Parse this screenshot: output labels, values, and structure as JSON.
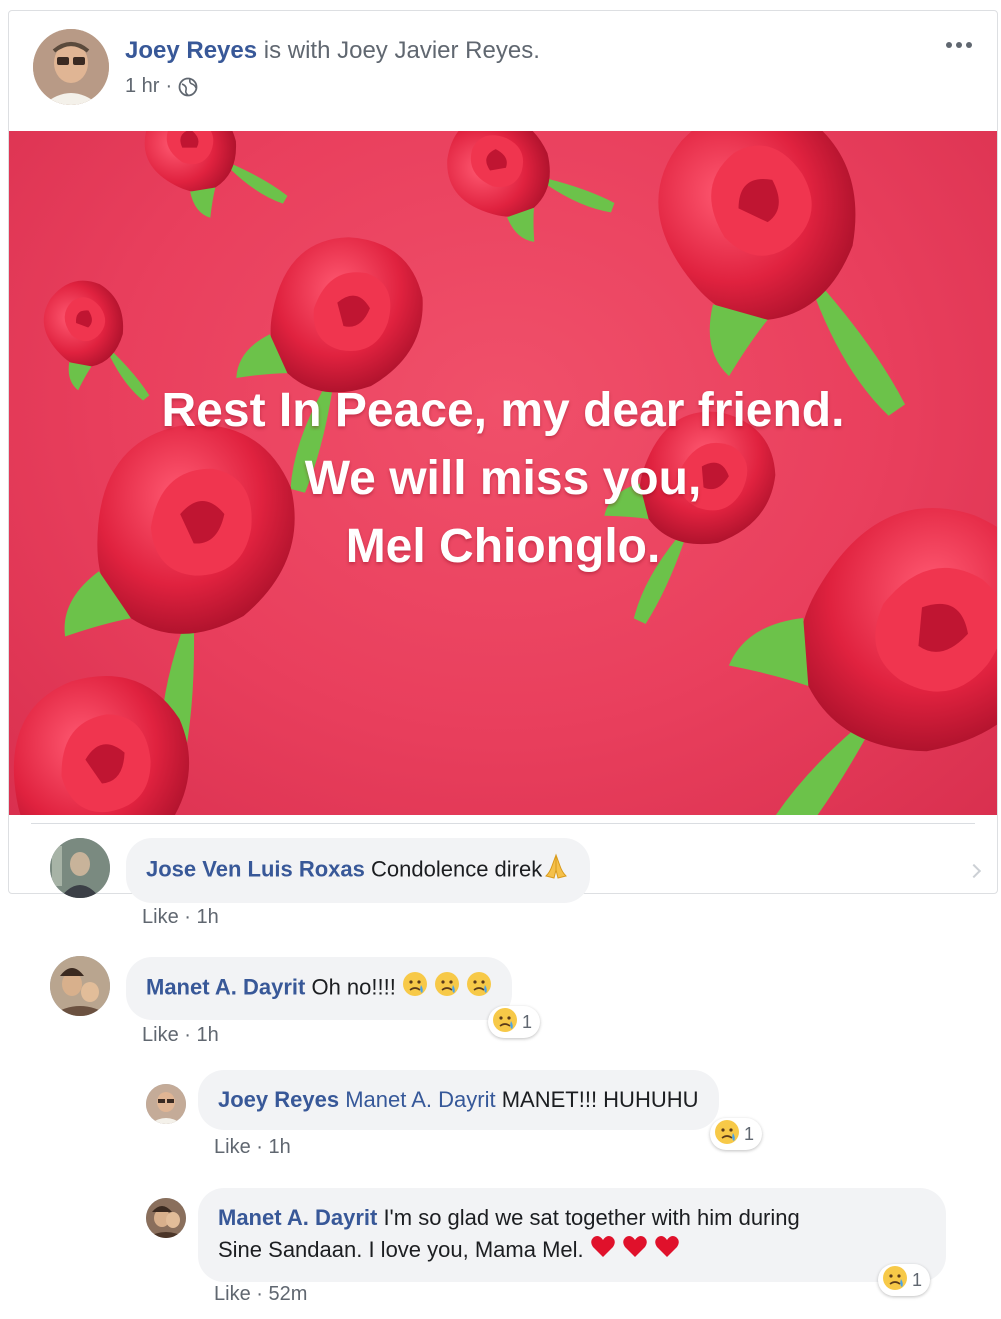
{
  "post": {
    "author": "Joey Reyes",
    "with_text": " is with Joey Javier Reyes.",
    "time": "1 hr",
    "time_sep": " · ",
    "image_lines": [
      "Rest In Peace, my dear friend.",
      "We will miss you,",
      "Mel Chionglo."
    ]
  },
  "comments": [
    {
      "name": "Jose Ven Luis Roxas",
      "text": "Condolence direk",
      "like": "Like",
      "sep": " · ",
      "time": "1h"
    },
    {
      "name": "Manet A. Dayrit",
      "text": "Oh no!!!! ",
      "like": "Like",
      "sep": " · ",
      "time": "1h",
      "reaction_count": "1"
    },
    {
      "name": "Joey Reyes",
      "tag": "Manet A. Dayrit",
      "text": " MANET!!! HUHUHU",
      "like": "Like",
      "sep": " · ",
      "time": "1h",
      "reaction_count": "1"
    },
    {
      "name": "Manet A. Dayrit",
      "text_line1": " I'm so glad we sat together with him during",
      "text_line2": "Sine Sandaan. I love you, Mama Mel. ",
      "like": "Like",
      "sep": " · ",
      "time": "52m",
      "reaction_count": "1"
    }
  ],
  "icons": {
    "globe": "globe-icon",
    "more": "more-options-icon",
    "sad": "crying-face-icon",
    "pray": "folded-hands-icon",
    "heart": "red-heart-icon"
  },
  "colors": {
    "name_link": "#385898",
    "bubble": "#f2f3f5",
    "meta": "#606770",
    "image_bg": "#e93f5d"
  }
}
